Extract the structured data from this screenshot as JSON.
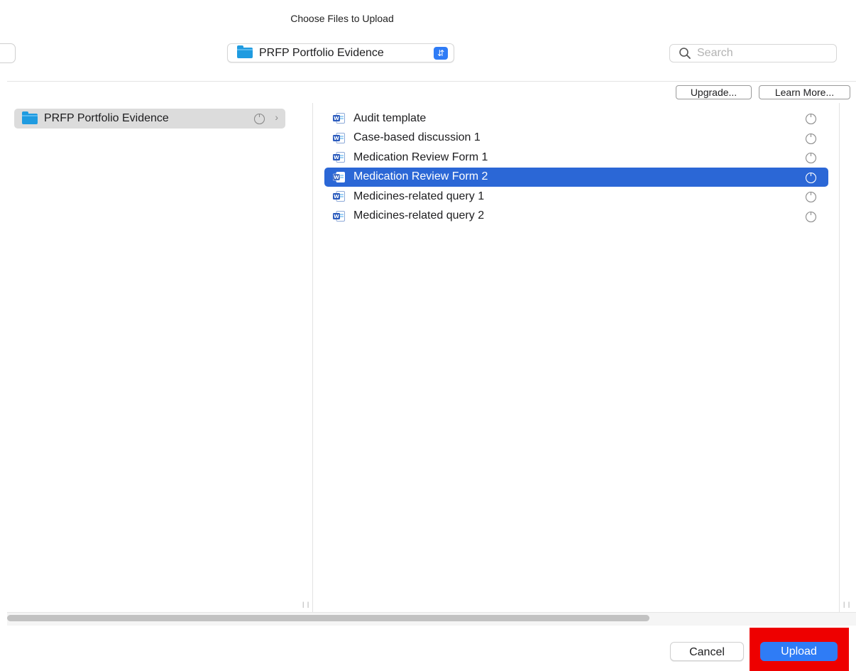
{
  "dialog": {
    "title": "Choose Files to Upload"
  },
  "toolbar": {
    "location": "PRFP Portfolio Evidence",
    "location_icon": "folder-icon",
    "search_placeholder": "Search"
  },
  "icloud_buttons": {
    "upgrade": "Upgrade...",
    "learn_more": "Learn More..."
  },
  "sidebar_column": {
    "items": [
      {
        "label": "PRFP Portfolio Evidence",
        "icon": "folder-icon",
        "selected": true
      }
    ]
  },
  "files": [
    {
      "name": "Audit template",
      "icon": "word-doc-icon",
      "selected": false
    },
    {
      "name": "Case-based discussion 1",
      "icon": "word-doc-icon",
      "selected": false
    },
    {
      "name": "Medication Review Form 1",
      "icon": "word-doc-icon",
      "selected": false
    },
    {
      "name": "Medication Review Form 2",
      "icon": "word-doc-icon",
      "selected": true
    },
    {
      "name": "Medicines-related query 1",
      "icon": "word-doc-icon",
      "selected": false
    },
    {
      "name": "Medicines-related query 2",
      "icon": "word-doc-icon",
      "selected": false
    }
  ],
  "footer": {
    "cancel": "Cancel",
    "upload": "Upload"
  },
  "colors": {
    "accent": "#2f7cf6",
    "selection": "#2b67d6",
    "highlight": "#ee0000",
    "folder": "#1f9be0"
  }
}
